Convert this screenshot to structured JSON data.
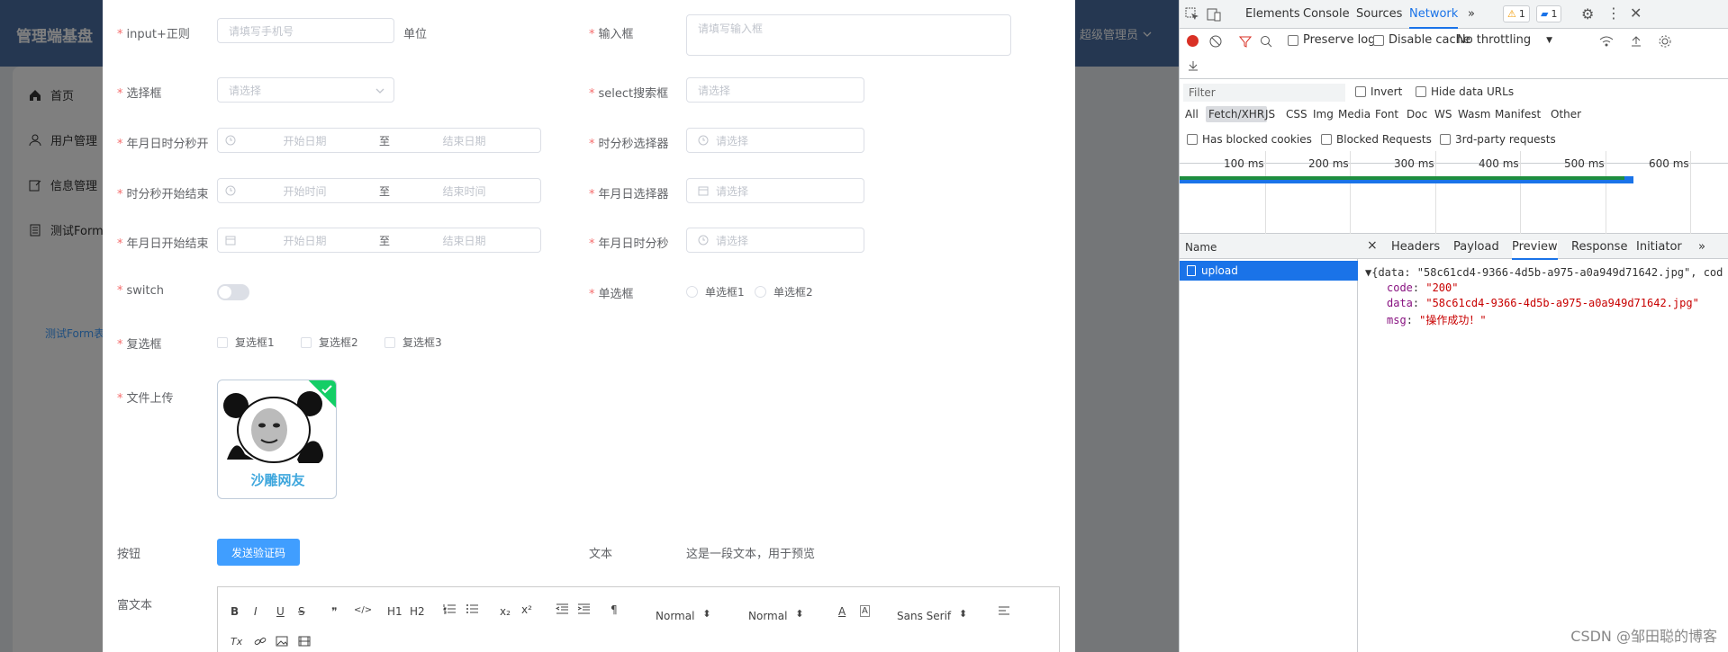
{
  "app": {
    "brand": "管理端基盘",
    "user": "超级管理员",
    "sidebar": [
      "首页",
      "用户管理",
      "信息管理",
      "测试Form"
    ],
    "sidebar_sub": "测试Form表"
  },
  "form": {
    "input_regex": {
      "label": "input+正则",
      "placeholder": "请填写手机号",
      "unit": "单位"
    },
    "textarea": {
      "label": "输入框",
      "placeholder": "请填写输入框"
    },
    "select": {
      "label": "选择框",
      "placeholder": "请选择"
    },
    "select_search": {
      "label": "select搜索框",
      "placeholder": "请选择"
    },
    "datetime_range": {
      "label": "年月日时分秒开",
      "start": "开始日期",
      "sep": "至",
      "end": "结束日期"
    },
    "time_picker": {
      "label": "时分秒选择器",
      "placeholder": "请选择"
    },
    "time_range": {
      "label": "时分秒开始结束",
      "start": "开始时间",
      "sep": "至",
      "end": "结束时间"
    },
    "date_picker": {
      "label": "年月日选择器",
      "placeholder": "请选择"
    },
    "date_range": {
      "label": "年月日开始结束",
      "start": "开始日期",
      "sep": "至",
      "end": "结束日期"
    },
    "datetime_picker": {
      "label": "年月日时分秒",
      "placeholder": "请选择"
    },
    "switch": {
      "label": "switch",
      "on": false
    },
    "radio": {
      "label": "单选框",
      "options": [
        "单选框1",
        "单选框2"
      ]
    },
    "checkbox": {
      "label": "复选框",
      "options": [
        "复选框1",
        "复选框2",
        "复选框3"
      ]
    },
    "upload": {
      "label": "文件上传",
      "caption": "沙雕网友"
    },
    "button_row": {
      "label": "按钮",
      "button": "发送验证码"
    },
    "text_row": {
      "label": "文本",
      "value": "这是一段文本，用于预览"
    },
    "richtext": {
      "label": "富文本",
      "tools": {
        "blockquote": "❞",
        "code": "</>",
        "h1": "H1",
        "h2": "H2",
        "sub": "x₂",
        "sup": "x²",
        "rtl": "¶",
        "color": "A",
        "clean": "Tx"
      },
      "select1": "Normal",
      "select2": "Normal",
      "font": "Sans Serif"
    }
  },
  "devtools": {
    "tabs": [
      "Elements",
      "Console",
      "Sources",
      "Network"
    ],
    "active_tab": "Network",
    "more": "»",
    "warnings": "1",
    "messages": "1",
    "preserve_log": "Preserve log",
    "disable_cache": "Disable cache",
    "throttling": "No throttling",
    "filter_placeholder": "Filter",
    "invert": "Invert",
    "hide_data_urls": "Hide data URLs",
    "types": [
      "All",
      "Fetch/XHR",
      "JS",
      "CSS",
      "Img",
      "Media",
      "Font",
      "Doc",
      "WS",
      "Wasm",
      "Manifest",
      "Other"
    ],
    "has_blocked_cookies": "Has blocked cookies",
    "blocked_requests": "Blocked Requests",
    "third_party": "3rd-party requests",
    "timeline": [
      "100 ms",
      "200 ms",
      "300 ms",
      "400 ms",
      "500 ms",
      "600 ms"
    ],
    "name_header": "Name",
    "request": "upload",
    "detail_close": "×",
    "detail_tabs": [
      "Headers",
      "Payload",
      "Preview",
      "Response",
      "Initiator"
    ],
    "detail_more": "»",
    "preview": {
      "summary": "{data: \"58c61cd4-9366-4d5b-a975-a0a949d71642.jpg\", cod",
      "code_key": "code",
      "code_val": "\"200\"",
      "data_key": "data",
      "data_val": "\"58c61cd4-9366-4d5b-a975-a0a949d71642.jpg\"",
      "msg_key": "msg",
      "msg_val": "\"操作成功！\""
    }
  },
  "watermark": "CSDN @邹田聪的博客"
}
